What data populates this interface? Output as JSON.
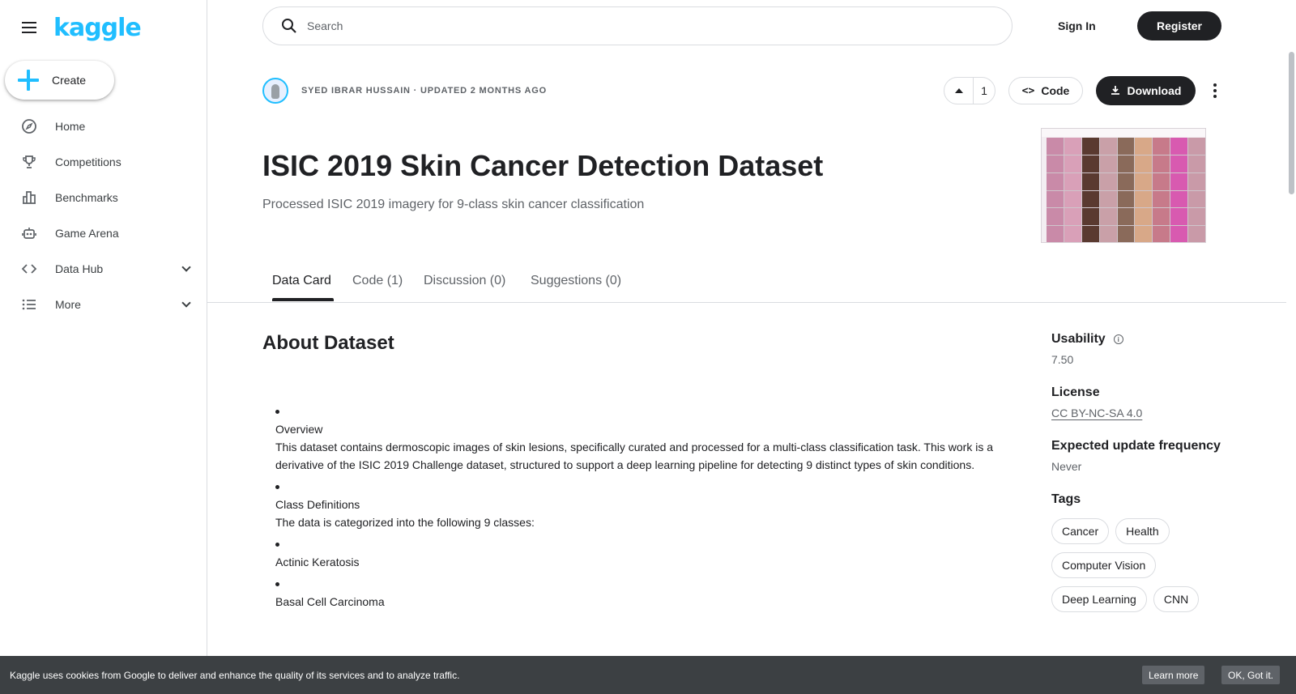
{
  "app": {
    "logo": "kaggle"
  },
  "sidebar": {
    "create_label": "Create",
    "items": [
      {
        "label": "Home",
        "icon": "compass-icon"
      },
      {
        "label": "Competitions",
        "icon": "trophy-icon"
      },
      {
        "label": "Benchmarks",
        "icon": "bar-chart-icon"
      },
      {
        "label": "Game Arena",
        "icon": "robot-icon"
      },
      {
        "label": "Data Hub",
        "icon": "code-icon"
      },
      {
        "label": "More",
        "icon": "list-icon"
      }
    ]
  },
  "topbar": {
    "search_placeholder": "Search",
    "signin_label": "Sign In",
    "register_label": "Register"
  },
  "dataset": {
    "author_line": "SYED IBRAR HUSSAIN · UPDATED 2 MONTHS AGO",
    "vote_count": "1",
    "code_label": "Code",
    "download_label": "Download",
    "title": "ISIC 2019 Skin Cancer Detection Dataset",
    "subtitle": "Processed ISIC 2019 imagery for 9-class skin cancer classification"
  },
  "tabs": [
    "Data Card",
    "Code (1)",
    "Discussion (0)",
    "Suggestions (0)"
  ],
  "about": {
    "heading": "About Dataset",
    "blocks": [
      {
        "title": "Overview",
        "text": "This dataset contains dermoscopic images of skin lesions, specifically curated and processed for a multi-class classification task. This work is a derivative of the ISIC 2019 Challenge dataset, structured to support a deep learning pipeline for detecting 9 distinct types of skin conditions."
      },
      {
        "title": "Class Definitions",
        "text": "The data is categorized into the following 9 classes:"
      },
      {
        "title": "Actinic Keratosis",
        "text": ""
      },
      {
        "title": "Basal Cell Carcinoma",
        "text": ""
      }
    ]
  },
  "side": {
    "usability_label": "Usability",
    "usability_value": "7.50",
    "license_label": "License",
    "license_value": "CC BY-NC-SA 4.0",
    "freq_label": "Expected update frequency",
    "freq_value": "Never",
    "tags_label": "Tags",
    "tags": [
      "Cancer",
      "Health",
      "Computer Vision",
      "Deep Learning",
      "CNN"
    ]
  },
  "cookie": {
    "text": "Kaggle uses cookies from Google to deliver and enhance the quality of its services and to analyze traffic.",
    "learn_more": "Learn more",
    "ok": "OK, Got it."
  },
  "colors": {
    "accent": "#20beff",
    "dark": "#202124"
  }
}
